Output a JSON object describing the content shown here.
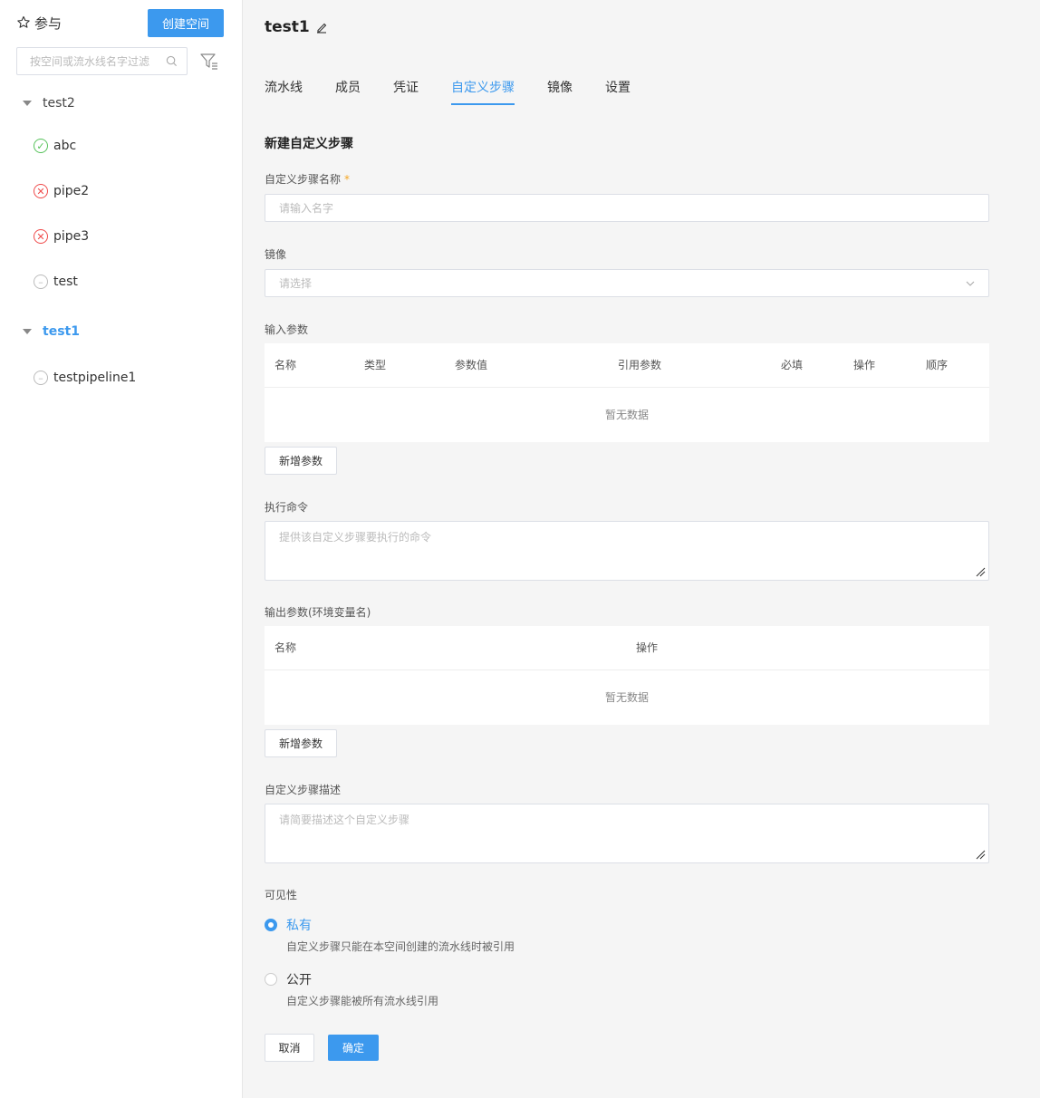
{
  "sidebar": {
    "title": "参与",
    "create_label": "创建空间",
    "search_placeholder": "按空间或流水线名字过滤",
    "groups": [
      {
        "label": "test2",
        "items": [
          {
            "label": "abc",
            "status": "success"
          },
          {
            "label": "pipe2",
            "status": "failed"
          },
          {
            "label": "pipe3",
            "status": "failed"
          },
          {
            "label": "test",
            "status": "none"
          }
        ]
      },
      {
        "label": "test1",
        "active": true,
        "items": [
          {
            "label": "testpipeline1",
            "status": "none"
          }
        ]
      }
    ]
  },
  "header": {
    "title": "test1"
  },
  "tabs": [
    "流水线",
    "成员",
    "凭证",
    "自定义步骤",
    "镜像",
    "设置"
  ],
  "active_tab": "自定义步骤",
  "form": {
    "section_title": "新建自定义步骤",
    "name_label": "自定义步骤名称",
    "name_required": "*",
    "name_placeholder": "请输入名字",
    "image_label": "镜像",
    "image_placeholder": "请选择",
    "input_params_label": "输入参数",
    "input_columns": [
      "名称",
      "类型",
      "参数值",
      "引用参数",
      "必填",
      "操作",
      "顺序"
    ],
    "empty_text": "暂无数据",
    "add_param_label": "新增参数",
    "command_label": "执行命令",
    "command_placeholder": "提供该自定义步骤要执行的命令",
    "output_params_label": "输出参数(环境变量名)",
    "output_columns": [
      "名称",
      "操作"
    ],
    "desc_label": "自定义步骤描述",
    "desc_placeholder": "请简要描述这个自定义步骤",
    "visibility_label": "可见性",
    "private_label": "私有",
    "private_desc": "自定义步骤只能在本空间创建的流水线时被引用",
    "public_label": "公开",
    "public_desc": "自定义步骤能被所有流水线引用",
    "cancel_label": "取消",
    "ok_label": "确定"
  },
  "colors": {
    "accent": "#3c99ee",
    "success": "#56c25a",
    "danger": "#ef4a4a"
  }
}
